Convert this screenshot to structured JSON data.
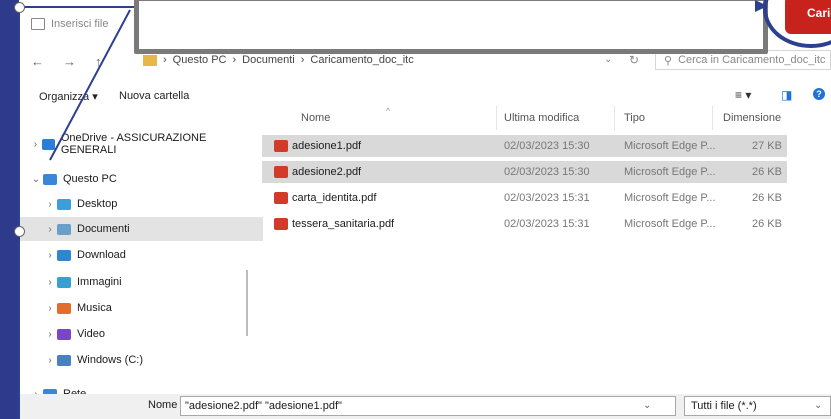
{
  "dialog": {
    "title": "Inserisci file"
  },
  "nav": {
    "back": "←",
    "forward": "→",
    "up": "↑"
  },
  "path": {
    "segments": [
      "Questo PC",
      "Documenti",
      "Caricamento_doc_itc"
    ],
    "sep": "›"
  },
  "search": {
    "placeholder": "Cerca in Caricamento_doc_itc"
  },
  "toolbar": {
    "organize": "Organizza ▾",
    "new_folder": "Nuova cartella",
    "view": "≡ ▾",
    "pane": "◨",
    "help": "?"
  },
  "sidebar": {
    "items": [
      {
        "label": "OneDrive - ASSICURAZIONE GENERALI",
        "chev": "›",
        "color": "#2a7fd4"
      },
      {
        "label": "Questo PC",
        "chev": "⌄",
        "color": "#3b86d6"
      },
      {
        "label": "Desktop",
        "chev": "›",
        "color": "#3d9fd9"
      },
      {
        "label": "Documenti",
        "chev": "›",
        "color": "#6aa0c8"
      },
      {
        "label": "Download",
        "chev": "›",
        "color": "#2f86d1"
      },
      {
        "label": "Immagini",
        "chev": "›",
        "color": "#3aa0d0"
      },
      {
        "label": "Musica",
        "chev": "›",
        "color": "#e46b2c"
      },
      {
        "label": "Video",
        "chev": "›",
        "color": "#7a46c8"
      },
      {
        "label": "Windows (C:)",
        "chev": "›",
        "color": "#4a7fc0"
      },
      {
        "label": "Rete",
        "chev": "›",
        "color": "#3b86d6"
      }
    ]
  },
  "list": {
    "headers": {
      "name": "Nome",
      "modified": "Ultima modifica",
      "type": "Tipo",
      "size": "Dimensione"
    },
    "rows": [
      {
        "name": "adesione1.pdf",
        "modified": "02/03/2023 15:30",
        "type": "Microsoft Edge P...",
        "size": "27 KB",
        "selected": true
      },
      {
        "name": "adesione2.pdf",
        "modified": "02/03/2023 15:30",
        "type": "Microsoft Edge P...",
        "size": "26 KB",
        "selected": true
      },
      {
        "name": "carta_identita.pdf",
        "modified": "02/03/2023 15:31",
        "type": "Microsoft Edge P...",
        "size": "26 KB",
        "selected": false
      },
      {
        "name": "tessera_sanitaria.pdf",
        "modified": "02/03/2023 15:31",
        "type": "Microsoft Edge P...",
        "size": "26 KB",
        "selected": false
      }
    ]
  },
  "footer": {
    "filename_label": "Nome file:",
    "filename_value": "\"adesione2.pdf\" \"adesione1.pdf\"",
    "filetype": "Tutti i file (*.*)"
  },
  "overlay_button": {
    "label": "Caric"
  },
  "colors": {
    "accent": "#c8221c",
    "annotation": "#2d3f8f"
  }
}
